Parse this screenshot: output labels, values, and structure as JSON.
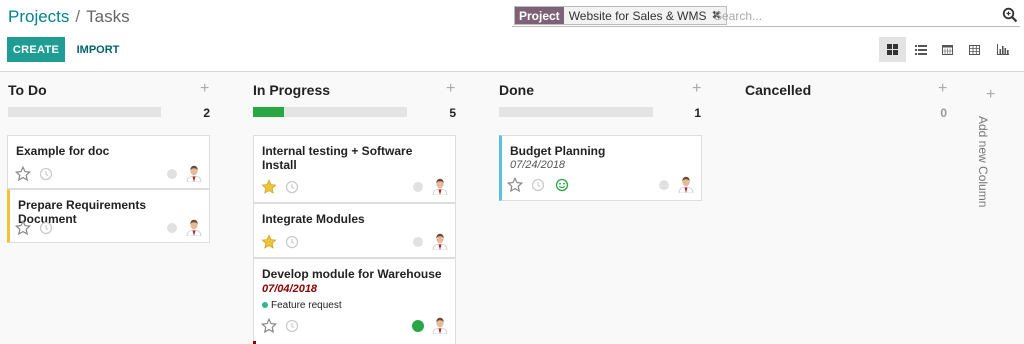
{
  "breadcrumb": {
    "parent": "Projects",
    "separator": "/",
    "current": "Tasks"
  },
  "search": {
    "facet_category": "Project",
    "facet_value": "Website for Sales & WMS",
    "placeholder": "Search..."
  },
  "actions": {
    "create": "CREATE",
    "import": "IMPORT"
  },
  "views": [
    "kanban-icon",
    "list-icon",
    "calendar-icon",
    "pivot-icon",
    "graph-icon"
  ],
  "colors": {
    "accent": "#1f9d95",
    "facet": "#7c6177",
    "progress": "#28a745",
    "star": "#f0c33c",
    "late": "#8b0000"
  },
  "columns": [
    {
      "title": "To Do",
      "count": "2",
      "progress": 0
    },
    {
      "title": "In Progress",
      "count": "5",
      "progress": 0.2
    },
    {
      "title": "Done",
      "count": "1",
      "progress": 0
    },
    {
      "title": "Cancelled",
      "count": "0",
      "progress": 0
    }
  ],
  "cards": {
    "todo_1": {
      "title": "Example for doc"
    },
    "todo_2": {
      "title": "Prepare Requirements Document"
    },
    "prog_1": {
      "title": "Internal testing + Software Install"
    },
    "prog_2": {
      "title": "Integrate Modules"
    },
    "prog_3": {
      "title": "Develop module for Warehouse",
      "date": "07/04/2018",
      "tag": "Feature request"
    },
    "done_1": {
      "title": "Budget Planning",
      "date": "07/24/2018"
    }
  },
  "add_column": "Add new Column"
}
